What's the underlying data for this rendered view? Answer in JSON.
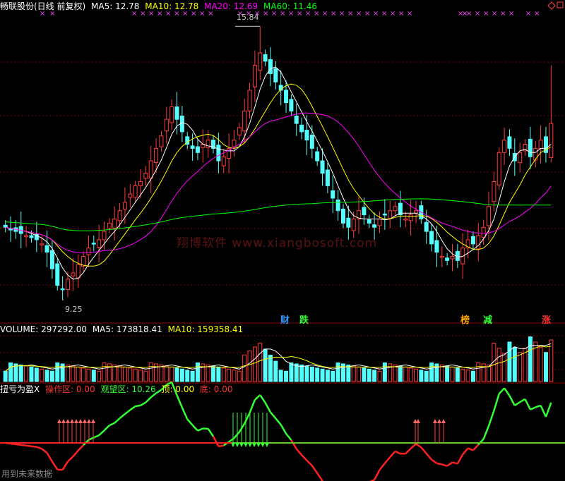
{
  "header": {
    "title": "畅联股份(日线 前复权)",
    "ma5": "MA5: 12.78",
    "ma10": "MA10: 12.78",
    "ma20": "MA20: 12.69",
    "ma60": "MA60: 11.46",
    "colors": {
      "title": "#ffffff",
      "ma5": "#ffffff",
      "ma10": "#ffff00",
      "ma20": "#ff00ff",
      "ma60": "#00ff00"
    }
  },
  "price_marks": {
    "high": "15.84",
    "low": "9.25"
  },
  "tags": [
    {
      "text": "财",
      "color": "#3399ff"
    },
    {
      "text": "跌",
      "color": "#33ff33"
    },
    {
      "text": "榜",
      "color": "#ffaa00"
    },
    {
      "text": "减",
      "color": "#33ff33"
    },
    {
      "text": "涨",
      "color": "#ff3333"
    }
  ],
  "volume_header": {
    "label": "VOLUME: 297292.00",
    "ma5": "MA5: 173818.41",
    "ma10": "MA10: 159358.41"
  },
  "indicator_header": {
    "name": "扭亏为盈X",
    "op": "操作区: 0.00",
    "watch": "观望区: 10.26",
    "top": "顶: 0.00",
    "bottom": "底: 0.00"
  },
  "watermark": "翔博软件 www.xiangbosoft.com",
  "footer_note": "用到未来数据",
  "chart_data": {
    "type": "candlestick",
    "price_range": [
      9.25,
      15.84
    ],
    "closes": [
      11.0,
      10.95,
      10.9,
      10.85,
      10.8,
      10.75,
      10.7,
      10.6,
      10.4,
      10.0,
      9.6,
      9.5,
      9.75,
      9.9,
      10.1,
      10.3,
      10.5,
      10.6,
      10.7,
      10.9,
      11.1,
      11.2,
      11.4,
      11.6,
      11.8,
      12.0,
      12.1,
      12.3,
      12.6,
      12.9,
      13.2,
      13.6,
      13.9,
      13.6,
      13.3,
      13.0,
      12.9,
      12.8,
      13.0,
      13.1,
      12.9,
      12.6,
      12.7,
      12.9,
      13.1,
      13.4,
      13.8,
      14.3,
      14.9,
      15.2,
      15.0,
      14.7,
      14.5,
      14.3,
      14.0,
      13.8,
      13.5,
      13.3,
      13.1,
      12.9,
      12.6,
      12.3,
      12.0,
      11.7,
      11.4,
      11.1,
      11.0,
      11.2,
      11.4,
      11.3,
      11.1,
      11.0,
      11.2,
      11.3,
      11.4,
      11.5,
      11.3,
      11.2,
      11.3,
      11.4,
      11.2,
      10.9,
      10.6,
      10.4,
      10.3,
      10.2,
      10.3,
      10.2,
      10.5,
      10.7,
      10.6,
      10.8,
      11.0,
      11.5,
      12.1,
      12.8,
      13.1,
      12.9,
      12.6,
      12.8,
      13.0,
      12.7,
      12.9,
      13.1,
      12.8,
      13.5
    ],
    "ma5_last": 12.78,
    "ma10_last": 12.78,
    "ma20_last": 12.69,
    "ma60_last": 11.46,
    "volume_last": 297292.0,
    "volume_ma5": 173818.41,
    "volume_ma10": 159358.41,
    "indicator": {
      "op": 0.0,
      "watch": 10.26,
      "top": 0.0,
      "bottom": 0.0
    }
  }
}
